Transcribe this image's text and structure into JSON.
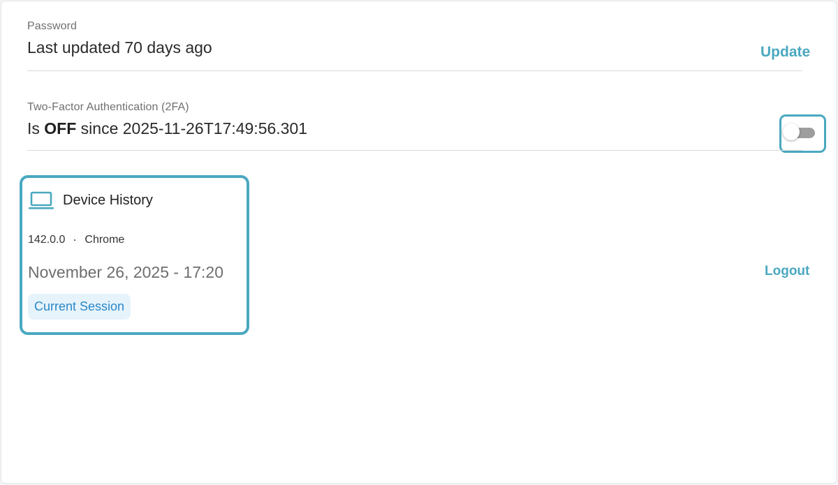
{
  "password": {
    "label": "Password",
    "value": "Last updated 70 days ago",
    "update_label": "Update"
  },
  "two_factor": {
    "label": "Two-Factor Authentication (2FA)",
    "value_prefix": "Is ",
    "status": "OFF",
    "value_suffix": " since 2025-11-26T17:49:56.301",
    "toggle_on": false
  },
  "device_history": {
    "title": "Device History",
    "icon": "laptop-icon",
    "version": "142.0.0",
    "separator": "·",
    "browser": "Chrome",
    "datetime": "November 26, 2025 - 17:20",
    "badge": "Current Session",
    "logout_label": "Logout"
  },
  "colors": {
    "accent": "#4aa8c0",
    "badge_bg": "#e6f3fb",
    "badge_text": "#2b88c8",
    "toggle_off": "#9e9e9e"
  }
}
